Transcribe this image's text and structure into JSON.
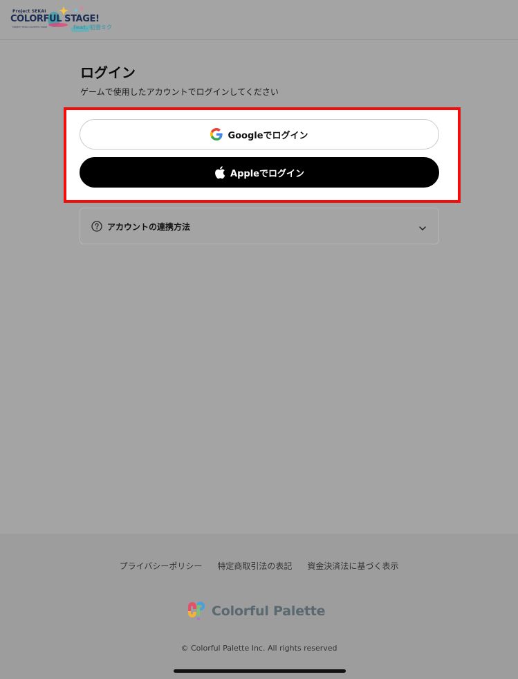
{
  "header": {
    "logo": {
      "small": "Project SEKAI",
      "main": "COLORFUL STAGE!",
      "sub": "PROJECT SEKAI COLORFUL STAGE",
      "feat": "feat. 初音ミク"
    }
  },
  "login": {
    "title": "ログイン",
    "subtitle": "ゲームで使用したアカウントでログインしてください",
    "google_label": "Googleでログイン",
    "apple_label": "Appleでログイン"
  },
  "accordion": {
    "label": "アカウントの連携方法"
  },
  "footer": {
    "links": [
      "プライバシーポリシー",
      "特定商取引法の表記",
      "資金決済法に基づく表示"
    ],
    "brand": "Colorful Palette",
    "copyright": "© Colorful Palette Inc. All rights reserved"
  },
  "colors": {
    "highlight": "#f20d0d",
    "apple_button": "#000000",
    "google_button": "#ffffff"
  },
  "icons": {
    "google": "google-g-icon",
    "apple": "apple-icon",
    "help": "question-circle-icon",
    "chevron": "chevron-down-icon"
  }
}
